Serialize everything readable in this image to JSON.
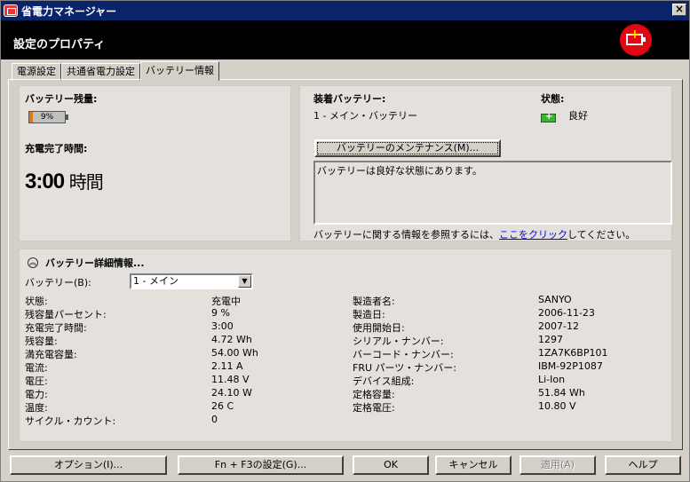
{
  "window": {
    "title": "省電力マネージャー",
    "close_label": "×"
  },
  "header": {
    "title": "設定のプロパティ"
  },
  "tabs": [
    {
      "label": "電源設定"
    },
    {
      "label": "共通省電力設定"
    },
    {
      "label": "バッテリー情報"
    }
  ],
  "battery_level": {
    "label": "バッテリー残量:",
    "percent_text": "9%",
    "percent": 9
  },
  "charge_time": {
    "label": "充電完了時間:",
    "value": "3:00",
    "unit": "時間"
  },
  "installed": {
    "label": "装着バッテリー:",
    "value": "1 - メイン・バッテリー"
  },
  "status": {
    "label": "状態:",
    "value": "良好"
  },
  "maintenance": {
    "button_label": "バッテリーのメンテナンス(M)...",
    "message": "バッテリーは良好な状態にあります。",
    "ref_prefix": "バッテリーに関する情報を参照するには、",
    "ref_link": "ここをクリック",
    "ref_suffix": "してください。"
  },
  "details": {
    "title": "バッテリー詳細情報...",
    "select_label": "バッテリー(B):",
    "select_value": "1 - メイン",
    "left": [
      {
        "label": "状態:",
        "value": "充電中"
      },
      {
        "label": "残容量パーセント:",
        "value": "9 %"
      },
      {
        "label": "充電完了時間:",
        "value": "3:00"
      },
      {
        "label": "残容量:",
        "value": "4.72 Wh"
      },
      {
        "label": "満充電容量:",
        "value": "54.00 Wh"
      },
      {
        "label": "電流:",
        "value": "2.11 A"
      },
      {
        "label": "電圧:",
        "value": "11.48 V"
      },
      {
        "label": "電力:",
        "value": "24.10 W"
      },
      {
        "label": "温度:",
        "value": "26 C"
      },
      {
        "label": "サイクル・カウント:",
        "value": "0"
      }
    ],
    "right": [
      {
        "label": "製造者名:",
        "value": "SANYO"
      },
      {
        "label": "製造日:",
        "value": "2006-11-23"
      },
      {
        "label": "使用開始日:",
        "value": "2007-12"
      },
      {
        "label": "シリアル・ナンバー:",
        "value": "1297"
      },
      {
        "label": "バーコード・ナンバー:",
        "value": "1ZA7K6BP101"
      },
      {
        "label": "FRU パーツ・ナンバー:",
        "value": "IBM-92P1087"
      },
      {
        "label": "デバイス組成:",
        "value": "Li-Ion"
      },
      {
        "label": "定格容量:",
        "value": "51.84 Wh"
      },
      {
        "label": "定格電圧:",
        "value": "10.80 V"
      }
    ]
  },
  "buttons": {
    "options": "オプション(I)...",
    "fn_f3": "Fn + F3の設定(G)...",
    "ok": "OK",
    "cancel": "キャンセル",
    "apply": "適用(A)",
    "help": "ヘルプ"
  },
  "colors": {
    "battery_fill": "#e07818",
    "brand_red": "#e30613",
    "status_green": "#3bb33b"
  }
}
